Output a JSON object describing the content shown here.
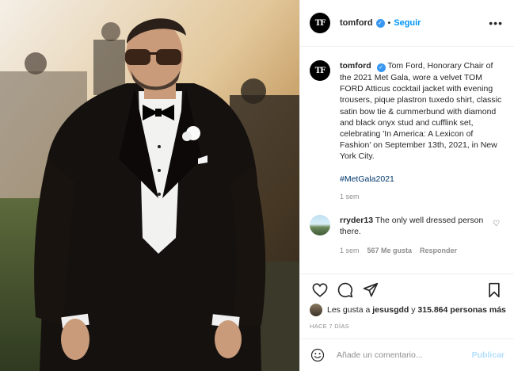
{
  "post": {
    "image_alt_label": "",
    "author": {
      "username": "tomford",
      "avatar_text": "TF",
      "verified_mark": "✓"
    },
    "header": {
      "follow_label": "Seguir",
      "separator": "•",
      "more_label": "•••"
    },
    "caption": {
      "username": "tomford",
      "text": "Tom Ford, Honorary Chair of the 2021 Met Gala, wore a velvet TOM FORD Atticus cocktail jacket with evening trousers, pique plastron tuxedo shirt, classic satin bow tie & cummerbund with diamond and black onyx stud and cufflink set, celebrating 'In America: A Lexicon of Fashion' on September 13th, 2021, in New York City.",
      "hashtag": "#MetGala2021",
      "time": "1 sem"
    },
    "comments": [
      {
        "username": "rryder13",
        "text": "The only well dressed person there.",
        "time": "1 sem",
        "likes": "567 Me gusta",
        "reply_label": "Responder"
      }
    ],
    "likes": {
      "prefix": "Les gusta a",
      "user": "jesusgdd",
      "connector": "y",
      "others": "315.864 personas más"
    },
    "posted_ago": "HACE 7 DÍAS",
    "add_comment": {
      "placeholder": "Añade un comentario...",
      "post_label": "Publicar"
    },
    "icons": {
      "like": "heart-icon",
      "comment": "comment-icon",
      "share": "send-icon",
      "save": "bookmark-icon",
      "emoji": "smiley-icon"
    },
    "colors": {
      "link_blue": "#0095f6",
      "verified_blue": "#3897f0",
      "muted_gray": "#8e8e8e",
      "hashtag": "#00376b",
      "post_disabled": "#b2dffc"
    }
  }
}
